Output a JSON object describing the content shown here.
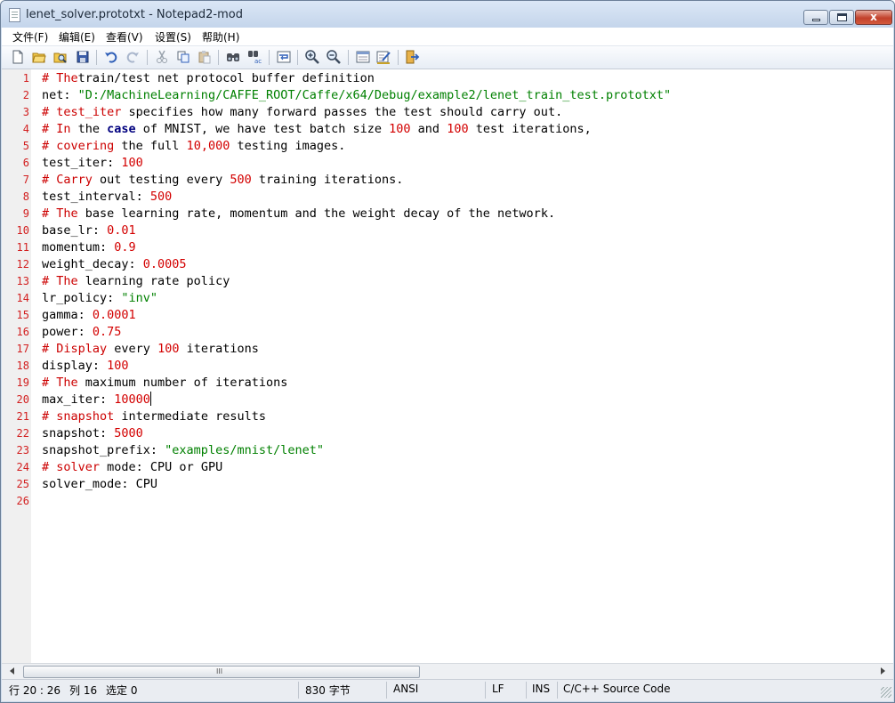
{
  "window": {
    "title": "lenet_solver.prototxt - Notepad2-mod",
    "close_glyph": "x"
  },
  "menu": [
    {
      "label": "文件(F)"
    },
    {
      "label": "编辑(E)"
    },
    {
      "label": "查看(V)"
    },
    {
      "label": "设置(S)"
    },
    {
      "label": "帮助(H)"
    }
  ],
  "toolbar": {
    "buttons": [
      "new-file-icon",
      "open-file-icon",
      "browse-icon",
      "save-icon",
      "undo-icon",
      "redo-icon",
      "cut-icon",
      "copy-icon",
      "paste-icon",
      "find-icon",
      "replace-icon",
      "word-wrap-icon",
      "zoom-in-icon",
      "zoom-out-icon",
      "scheme-icon",
      "customize-icon",
      "exit-icon"
    ]
  },
  "editor": {
    "lines": [
      {
        "n": "1",
        "segs": [
          [
            "c",
            "# The"
          ],
          [
            "",
            "train/test net protocol buffer definition"
          ]
        ]
      },
      {
        "n": "2",
        "segs": [
          [
            "",
            "net: "
          ],
          [
            "g",
            "\"D:/MachineLearning/CAFFE_ROOT/Caffe/x64/Debug/example2/lenet_train_test.prototxt\""
          ]
        ]
      },
      {
        "n": "3",
        "segs": [
          [
            "c",
            "# test_iter"
          ],
          [
            "",
            " specifies how many forward passes the test should carry out."
          ]
        ]
      },
      {
        "n": "4",
        "segs": [
          [
            "c",
            "# In"
          ],
          [
            "",
            " the "
          ],
          [
            "k",
            "case"
          ],
          [
            "",
            " of MNIST, we have test batch size "
          ],
          [
            "n",
            "100"
          ],
          [
            "",
            " and "
          ],
          [
            "n",
            "100"
          ],
          [
            "",
            " test iterations,"
          ]
        ]
      },
      {
        "n": "5",
        "segs": [
          [
            "c",
            "# covering"
          ],
          [
            "",
            " the full "
          ],
          [
            "n",
            "10,000"
          ],
          [
            "",
            " testing images."
          ]
        ]
      },
      {
        "n": "6",
        "segs": [
          [
            "",
            "test_iter: "
          ],
          [
            "n",
            "100"
          ]
        ]
      },
      {
        "n": "7",
        "segs": [
          [
            "c",
            "# Carry"
          ],
          [
            "",
            " out testing every "
          ],
          [
            "n",
            "500"
          ],
          [
            "",
            " training iterations."
          ]
        ]
      },
      {
        "n": "8",
        "segs": [
          [
            "",
            "test_interval: "
          ],
          [
            "n",
            "500"
          ]
        ]
      },
      {
        "n": "9",
        "segs": [
          [
            "c",
            "# The"
          ],
          [
            "",
            " base learning rate, momentum and the weight decay of the network."
          ]
        ]
      },
      {
        "n": "10",
        "segs": [
          [
            "",
            "base_lr: "
          ],
          [
            "n",
            "0.01"
          ]
        ]
      },
      {
        "n": "11",
        "segs": [
          [
            "",
            "momentum: "
          ],
          [
            "n",
            "0.9"
          ]
        ]
      },
      {
        "n": "12",
        "segs": [
          [
            "",
            "weight_decay: "
          ],
          [
            "n",
            "0.0005"
          ]
        ]
      },
      {
        "n": "13",
        "segs": [
          [
            "c",
            "# The"
          ],
          [
            "",
            " learning rate policy"
          ]
        ]
      },
      {
        "n": "14",
        "segs": [
          [
            "",
            "lr_policy: "
          ],
          [
            "g",
            "\"inv\""
          ]
        ]
      },
      {
        "n": "15",
        "segs": [
          [
            "",
            "gamma: "
          ],
          [
            "n",
            "0.0001"
          ]
        ]
      },
      {
        "n": "16",
        "segs": [
          [
            "",
            "power: "
          ],
          [
            "n",
            "0.75"
          ]
        ]
      },
      {
        "n": "17",
        "segs": [
          [
            "c",
            "# Display"
          ],
          [
            "",
            " every "
          ],
          [
            "n",
            "100"
          ],
          [
            "",
            " iterations"
          ]
        ]
      },
      {
        "n": "18",
        "segs": [
          [
            "",
            "display: "
          ],
          [
            "n",
            "100"
          ]
        ]
      },
      {
        "n": "19",
        "segs": [
          [
            "c",
            "# The"
          ],
          [
            "",
            " maximum number of iterations"
          ]
        ]
      },
      {
        "n": "20",
        "segs": [
          [
            "",
            "max_iter: "
          ],
          [
            "n",
            "10000"
          ]
        ],
        "caret": true
      },
      {
        "n": "21",
        "segs": [
          [
            "c",
            "# snapshot"
          ],
          [
            "",
            " intermediate results"
          ]
        ]
      },
      {
        "n": "22",
        "segs": [
          [
            "",
            "snapshot: "
          ],
          [
            "n",
            "5000"
          ]
        ]
      },
      {
        "n": "23",
        "segs": [
          [
            "",
            "snapshot_prefix: "
          ],
          [
            "g",
            "\"examples/mnist/lenet\""
          ]
        ]
      },
      {
        "n": "24",
        "segs": [
          [
            "c",
            "# solver"
          ],
          [
            "",
            " mode: CPU or GPU"
          ]
        ]
      },
      {
        "n": "25",
        "segs": [
          [
            "",
            "solver_mode: CPU"
          ]
        ]
      },
      {
        "n": "26",
        "segs": []
      }
    ]
  },
  "scrollbar": {
    "grip": "III"
  },
  "status": {
    "position": "行 20 : 26",
    "column": "列 16",
    "selection": "选定 0",
    "size": "830 字节",
    "encoding": "ANSI",
    "line_ending": "LF",
    "mode": "INS",
    "lexer": "C/C++ Source Code"
  }
}
